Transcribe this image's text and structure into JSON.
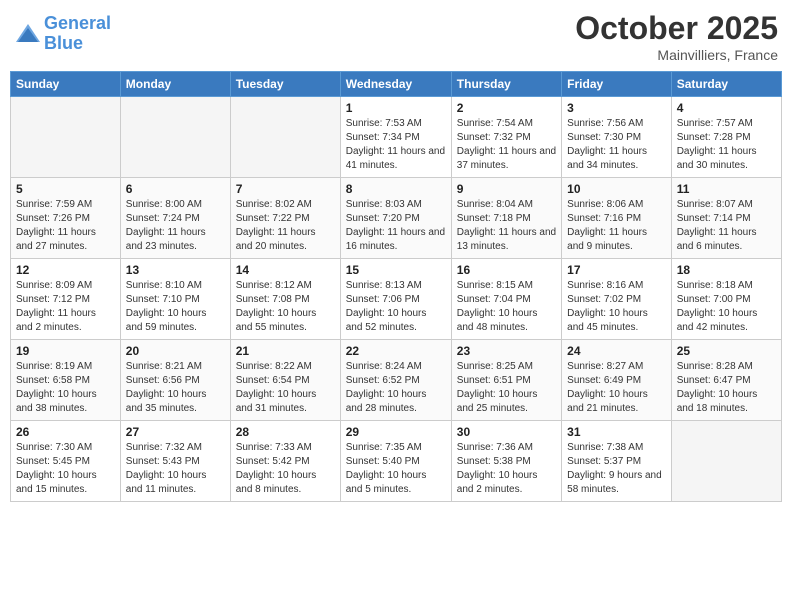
{
  "header": {
    "logo_line1": "General",
    "logo_line2": "Blue",
    "month": "October 2025",
    "location": "Mainvilliers, France"
  },
  "weekdays": [
    "Sunday",
    "Monday",
    "Tuesday",
    "Wednesday",
    "Thursday",
    "Friday",
    "Saturday"
  ],
  "weeks": [
    [
      {
        "day": "",
        "info": ""
      },
      {
        "day": "",
        "info": ""
      },
      {
        "day": "",
        "info": ""
      },
      {
        "day": "1",
        "info": "Sunrise: 7:53 AM\nSunset: 7:34 PM\nDaylight: 11 hours and 41 minutes."
      },
      {
        "day": "2",
        "info": "Sunrise: 7:54 AM\nSunset: 7:32 PM\nDaylight: 11 hours and 37 minutes."
      },
      {
        "day": "3",
        "info": "Sunrise: 7:56 AM\nSunset: 7:30 PM\nDaylight: 11 hours and 34 minutes."
      },
      {
        "day": "4",
        "info": "Sunrise: 7:57 AM\nSunset: 7:28 PM\nDaylight: 11 hours and 30 minutes."
      }
    ],
    [
      {
        "day": "5",
        "info": "Sunrise: 7:59 AM\nSunset: 7:26 PM\nDaylight: 11 hours and 27 minutes."
      },
      {
        "day": "6",
        "info": "Sunrise: 8:00 AM\nSunset: 7:24 PM\nDaylight: 11 hours and 23 minutes."
      },
      {
        "day": "7",
        "info": "Sunrise: 8:02 AM\nSunset: 7:22 PM\nDaylight: 11 hours and 20 minutes."
      },
      {
        "day": "8",
        "info": "Sunrise: 8:03 AM\nSunset: 7:20 PM\nDaylight: 11 hours and 16 minutes."
      },
      {
        "day": "9",
        "info": "Sunrise: 8:04 AM\nSunset: 7:18 PM\nDaylight: 11 hours and 13 minutes."
      },
      {
        "day": "10",
        "info": "Sunrise: 8:06 AM\nSunset: 7:16 PM\nDaylight: 11 hours and 9 minutes."
      },
      {
        "day": "11",
        "info": "Sunrise: 8:07 AM\nSunset: 7:14 PM\nDaylight: 11 hours and 6 minutes."
      }
    ],
    [
      {
        "day": "12",
        "info": "Sunrise: 8:09 AM\nSunset: 7:12 PM\nDaylight: 11 hours and 2 minutes."
      },
      {
        "day": "13",
        "info": "Sunrise: 8:10 AM\nSunset: 7:10 PM\nDaylight: 10 hours and 59 minutes."
      },
      {
        "day": "14",
        "info": "Sunrise: 8:12 AM\nSunset: 7:08 PM\nDaylight: 10 hours and 55 minutes."
      },
      {
        "day": "15",
        "info": "Sunrise: 8:13 AM\nSunset: 7:06 PM\nDaylight: 10 hours and 52 minutes."
      },
      {
        "day": "16",
        "info": "Sunrise: 8:15 AM\nSunset: 7:04 PM\nDaylight: 10 hours and 48 minutes."
      },
      {
        "day": "17",
        "info": "Sunrise: 8:16 AM\nSunset: 7:02 PM\nDaylight: 10 hours and 45 minutes."
      },
      {
        "day": "18",
        "info": "Sunrise: 8:18 AM\nSunset: 7:00 PM\nDaylight: 10 hours and 42 minutes."
      }
    ],
    [
      {
        "day": "19",
        "info": "Sunrise: 8:19 AM\nSunset: 6:58 PM\nDaylight: 10 hours and 38 minutes."
      },
      {
        "day": "20",
        "info": "Sunrise: 8:21 AM\nSunset: 6:56 PM\nDaylight: 10 hours and 35 minutes."
      },
      {
        "day": "21",
        "info": "Sunrise: 8:22 AM\nSunset: 6:54 PM\nDaylight: 10 hours and 31 minutes."
      },
      {
        "day": "22",
        "info": "Sunrise: 8:24 AM\nSunset: 6:52 PM\nDaylight: 10 hours and 28 minutes."
      },
      {
        "day": "23",
        "info": "Sunrise: 8:25 AM\nSunset: 6:51 PM\nDaylight: 10 hours and 25 minutes."
      },
      {
        "day": "24",
        "info": "Sunrise: 8:27 AM\nSunset: 6:49 PM\nDaylight: 10 hours and 21 minutes."
      },
      {
        "day": "25",
        "info": "Sunrise: 8:28 AM\nSunset: 6:47 PM\nDaylight: 10 hours and 18 minutes."
      }
    ],
    [
      {
        "day": "26",
        "info": "Sunrise: 7:30 AM\nSunset: 5:45 PM\nDaylight: 10 hours and 15 minutes."
      },
      {
        "day": "27",
        "info": "Sunrise: 7:32 AM\nSunset: 5:43 PM\nDaylight: 10 hours and 11 minutes."
      },
      {
        "day": "28",
        "info": "Sunrise: 7:33 AM\nSunset: 5:42 PM\nDaylight: 10 hours and 8 minutes."
      },
      {
        "day": "29",
        "info": "Sunrise: 7:35 AM\nSunset: 5:40 PM\nDaylight: 10 hours and 5 minutes."
      },
      {
        "day": "30",
        "info": "Sunrise: 7:36 AM\nSunset: 5:38 PM\nDaylight: 10 hours and 2 minutes."
      },
      {
        "day": "31",
        "info": "Sunrise: 7:38 AM\nSunset: 5:37 PM\nDaylight: 9 hours and 58 minutes."
      },
      {
        "day": "",
        "info": ""
      }
    ]
  ]
}
